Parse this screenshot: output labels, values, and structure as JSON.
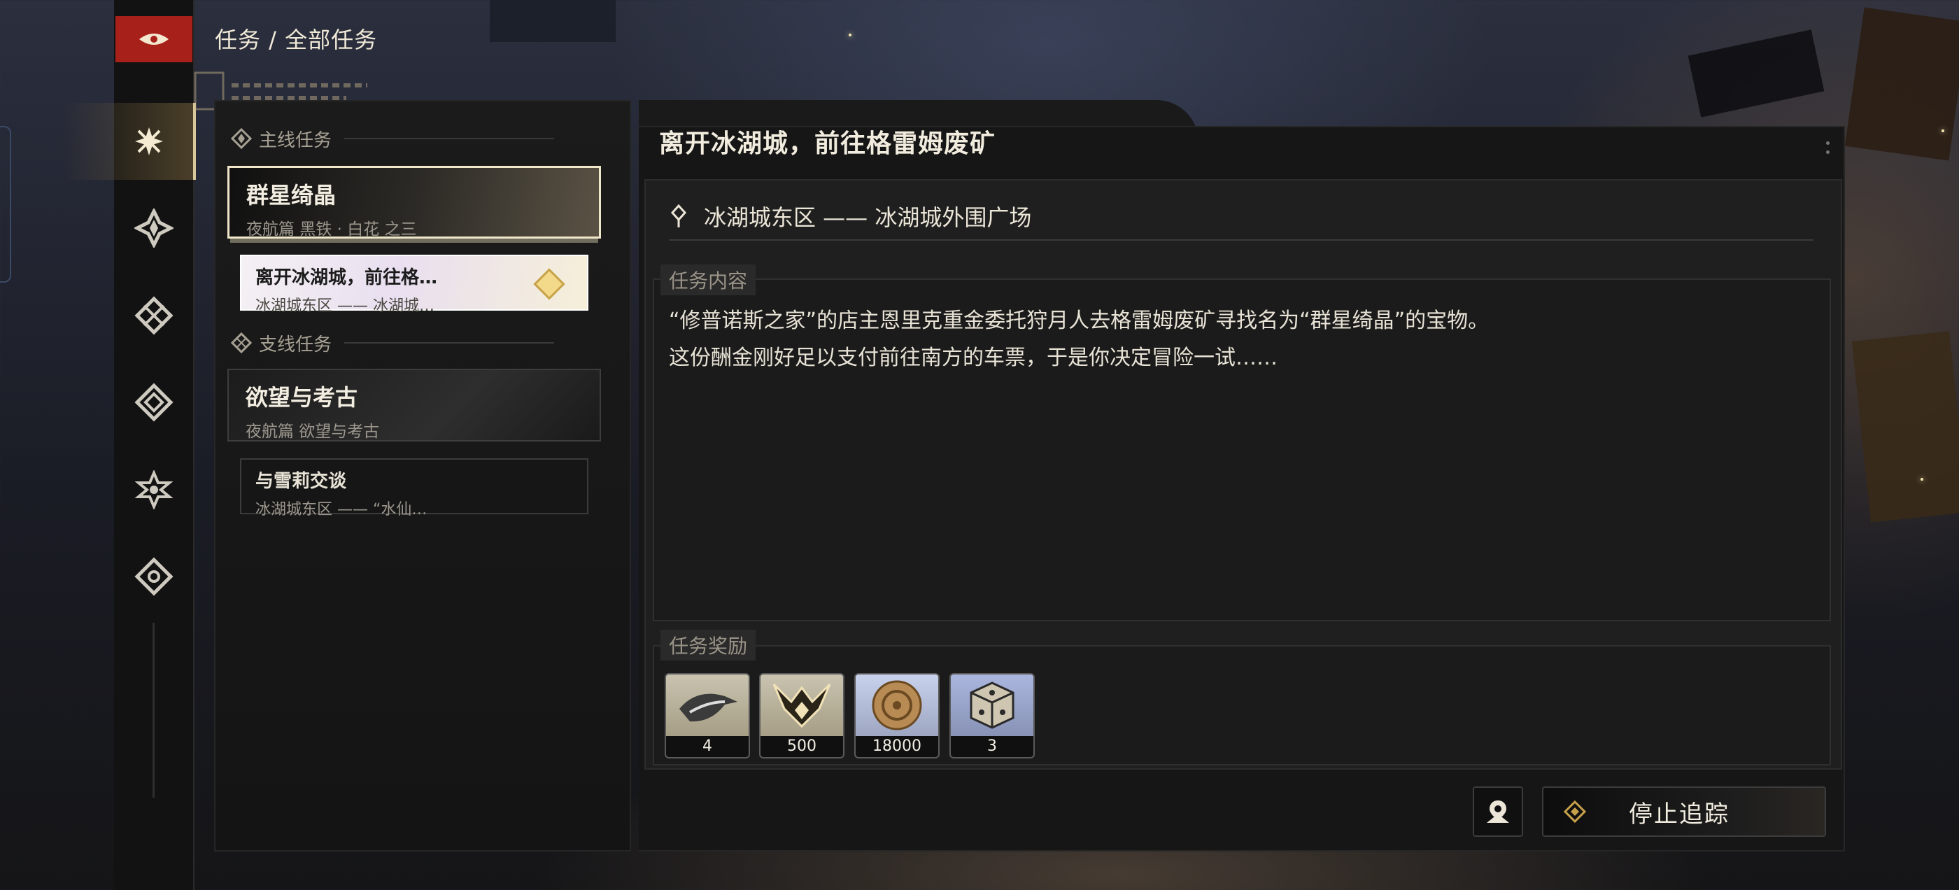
{
  "header": {
    "breadcrumb": "任务 / 全部任务"
  },
  "sidebar": {
    "icons": [
      {
        "name": "all-quests-icon",
        "active": true
      },
      {
        "name": "main-quest-icon",
        "active": false
      },
      {
        "name": "side-quest-icon",
        "active": false
      },
      {
        "name": "character-quest-icon",
        "active": false
      },
      {
        "name": "event-quest-icon",
        "active": false
      },
      {
        "name": "daily-quest-icon",
        "active": false
      }
    ]
  },
  "quest_list": {
    "main_section_label": "主线任务",
    "side_section_label": "支线任务",
    "main_quest": {
      "title": "群星绮晶",
      "subtitle": "夜航篇 黑铁 · 白花 之三"
    },
    "main_subquest": {
      "title": "离开冰湖城，前往格…",
      "subtitle": "冰湖城东区 —— 冰湖城…"
    },
    "side_quest": {
      "title": "欲望与考古",
      "subtitle": "夜航篇 欲望与考古"
    },
    "side_subquest": {
      "title": "与雪莉交谈",
      "subtitle": "冰湖城东区 —— “水仙…"
    }
  },
  "detail": {
    "title": "离开冰湖城，前往格雷姆废矿",
    "location": "冰湖城东区 —— 冰湖城外围广场",
    "content_label": "任务内容",
    "content_line1": "“修普诺斯之家”的店主恩里克重金委托狩月人去格雷姆废矿寻找名为“群星绮晶”的宝物。",
    "content_line2": "这份酬金刚好足以支付前往南方的车票，于是你决定冒险一试……",
    "reward_label": "任务奖励",
    "rewards": [
      {
        "icon": "bird-item-icon",
        "qty": "4"
      },
      {
        "icon": "horned-emblem-icon",
        "qty": "500"
      },
      {
        "icon": "coin-icon",
        "qty": "18000"
      },
      {
        "icon": "dice-cube-icon",
        "qty": "3"
      }
    ]
  },
  "actions": {
    "stop_tracking": "停止追踪"
  },
  "colors": {
    "accent_red": "#a8201a",
    "gold": "#c8a24a",
    "panel": "#161616"
  }
}
